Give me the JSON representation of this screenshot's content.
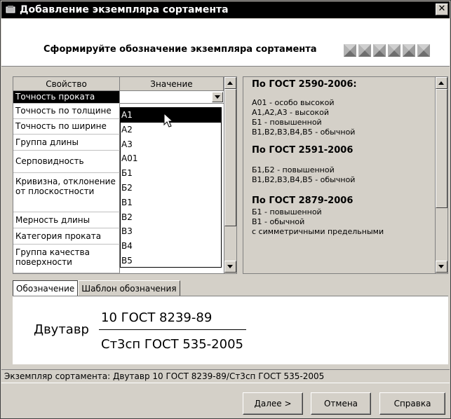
{
  "window": {
    "title": "Добавление экземпляра сортамента",
    "heading": "Сформируйте обозначение экземпляра сортамента",
    "steps_total": 6
  },
  "grid": {
    "col_property": "Свойство",
    "col_value": "Значение",
    "rows": [
      {
        "label": "Точность проката"
      },
      {
        "label": "Точность по толщине"
      },
      {
        "label": "Точность по ширине"
      },
      {
        "label": "Группа длины"
      },
      {
        "label": "Серповидность"
      },
      {
        "label": "Кривизна, отклонение от плоскостности"
      },
      {
        "label": "Мерность длины"
      },
      {
        "label": "Категория проката"
      },
      {
        "label": "Группа качества поверхности"
      }
    ]
  },
  "dropdown": {
    "options": [
      "А1",
      "А2",
      "А3",
      "А01",
      "Б1",
      "Б2",
      "В1",
      "В2",
      "В3",
      "В4",
      "В5"
    ],
    "selected_index": 0
  },
  "info": {
    "heading1": "По ГОСТ 2590-2006:",
    "lines1": [
      "А01 - особо высокой",
      "А1,А2,А3 - высокой",
      "Б1 - повышенной",
      "В1,В2,В3,В4,В5 - обычной"
    ],
    "heading2": "По ГОСТ 2591-2006",
    "lines2": [
      "Б1,Б2 - повышенной",
      "В1,В2,В3,В4,В5 - обычной"
    ],
    "heading3": "По ГОСТ 2879-2006",
    "lines3": [
      "Б1 - повышенной",
      "В1 - обычной",
      "с симметричными предельными"
    ]
  },
  "tabs": [
    "Обозначение",
    "Шаблон обозначения"
  ],
  "formula": {
    "name": "Двутавр",
    "numerator": "10 ГОСТ 8239-89",
    "denominator": "Ст3сп ГОСТ 535-2005"
  },
  "status": "Экземпляр сортамента: Двутавр 10 ГОСТ 8239-89/Ст3сп ГОСТ 535-2005",
  "buttons": {
    "next": "Далее >",
    "cancel": "Отмена",
    "help": "Справка"
  },
  "icons": {
    "app": "sortament-icon",
    "close": "close-icon",
    "step": "step-marker-icon",
    "pointer": "mouse-pointer-icon"
  }
}
